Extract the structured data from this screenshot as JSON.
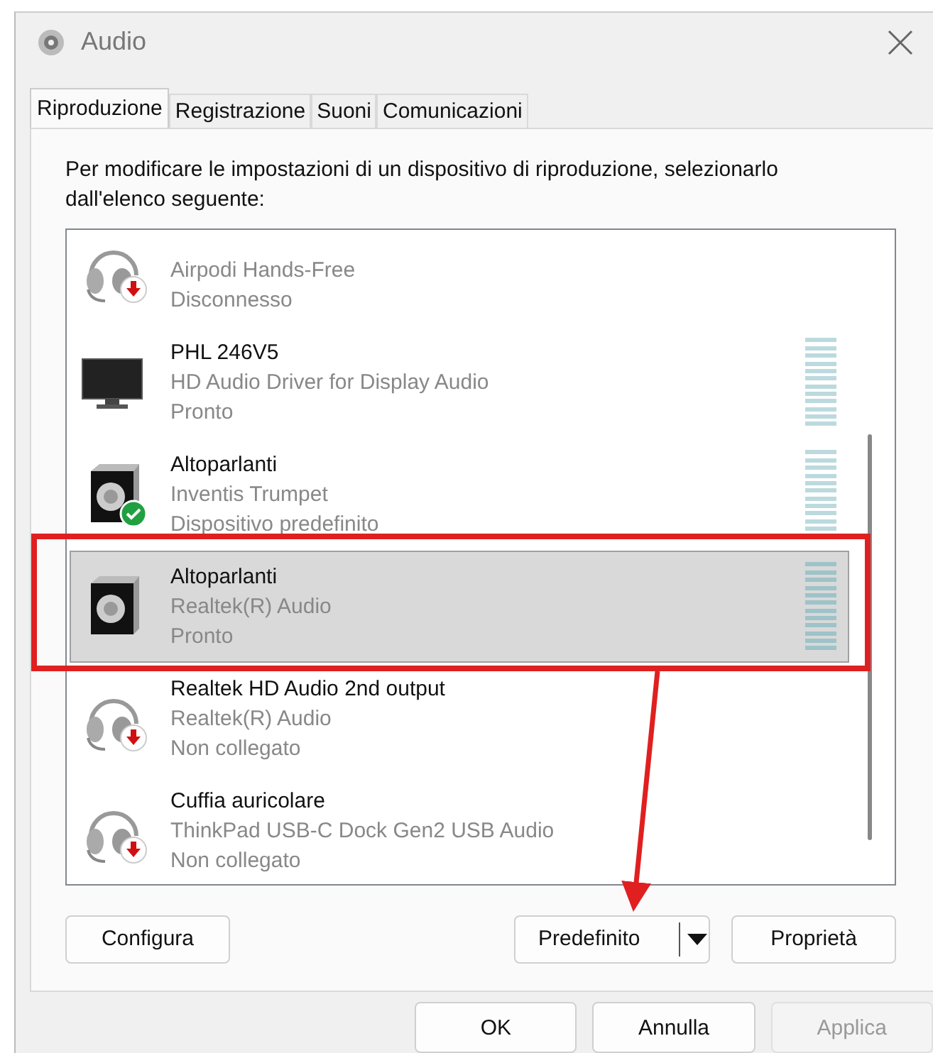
{
  "window": {
    "title": "Audio"
  },
  "tabs": [
    {
      "label": "Riproduzione",
      "selected": true
    },
    {
      "label": "Registrazione",
      "selected": false
    },
    {
      "label": "Suoni",
      "selected": false
    },
    {
      "label": "Comunicazioni",
      "selected": false
    }
  ],
  "instructions": "Per modificare le impostazioni di un dispositivo di riproduzione, selezionarlo dall'elenco seguente:",
  "devices": [
    {
      "kind": "headset",
      "unplugged": true,
      "is_default": false,
      "description": "Airpodi Hands-Free",
      "status": "Disconnesso",
      "meter": false,
      "selected": false
    },
    {
      "kind": "monitor",
      "unplugged": false,
      "is_default": false,
      "name": "PHL 246V5",
      "description": "HD Audio Driver for Display Audio",
      "status": "Pronto",
      "meter": true,
      "selected": false
    },
    {
      "kind": "speaker",
      "unplugged": false,
      "is_default": true,
      "name": "Altoparlanti",
      "description": "Inventis Trumpet",
      "status": "Dispositivo predefinito",
      "meter": true,
      "selected": false
    },
    {
      "kind": "speaker",
      "unplugged": false,
      "is_default": false,
      "name": "Altoparlanti",
      "description": "Realtek(R) Audio",
      "status": "Pronto",
      "meter": true,
      "selected": true
    },
    {
      "kind": "headset",
      "unplugged": true,
      "is_default": false,
      "name": "Realtek HD Audio 2nd output",
      "description": "Realtek(R) Audio",
      "status": "Non collegato",
      "meter": false,
      "selected": false
    },
    {
      "kind": "headset",
      "unplugged": true,
      "is_default": false,
      "name": "Cuffia auricolare",
      "description": "ThinkPad USB-C Dock Gen2 USB Audio",
      "status": "Non collegato",
      "meter": false,
      "selected": false
    }
  ],
  "device_buttons": [
    {
      "label": "Configura",
      "kind": "plain"
    },
    {
      "label": "Predefinito",
      "kind": "split"
    },
    {
      "label": "Proprietà",
      "kind": "plain"
    }
  ],
  "dialog_buttons": [
    {
      "label": "OK",
      "disabled": false
    },
    {
      "label": "Annulla",
      "disabled": false
    },
    {
      "label": "Applica",
      "disabled": true
    }
  ]
}
